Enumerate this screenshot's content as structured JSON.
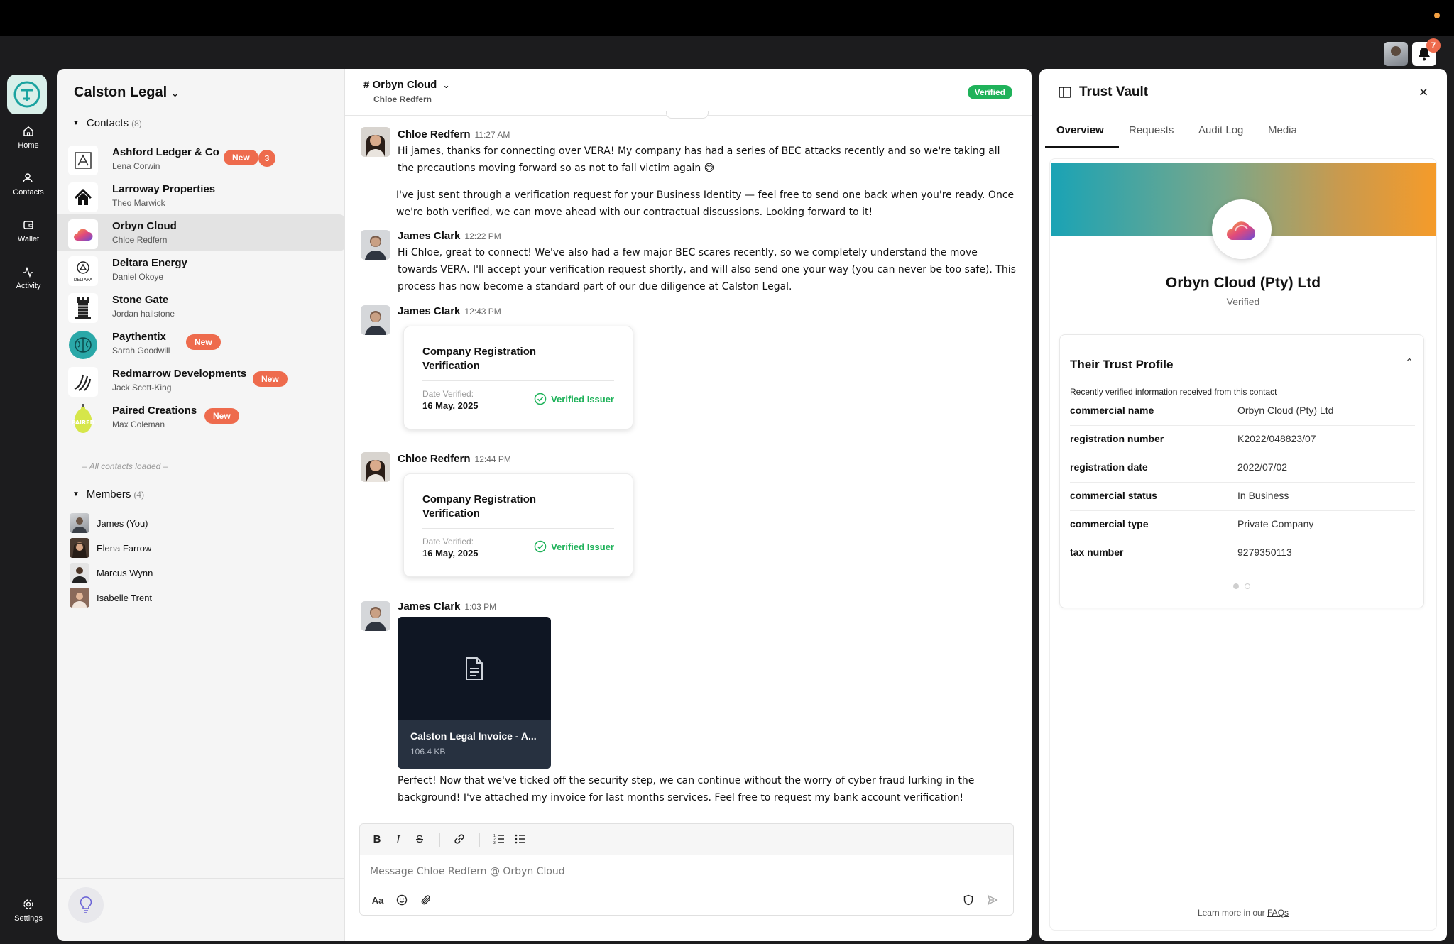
{
  "notifications": {
    "count": "7"
  },
  "rail": {
    "items": [
      {
        "label": "Home",
        "icon": "home-icon"
      },
      {
        "label": "Contacts",
        "icon": "contacts-icon"
      },
      {
        "label": "Wallet",
        "icon": "wallet-icon"
      },
      {
        "label": "Activity",
        "icon": "activity-icon"
      }
    ],
    "settings_label": "Settings"
  },
  "sidebar": {
    "org_name": "Calston Legal",
    "contacts_label": "Contacts",
    "contacts_count": "(8)",
    "contacts": [
      {
        "name": "Ashford Ledger & Co",
        "person": "Lena Corwin",
        "badge": "New",
        "count": "3"
      },
      {
        "name": "Larroway Properties",
        "person": "Theo Marwick"
      },
      {
        "name": "Orbyn Cloud",
        "person": "Chloe Redfern",
        "selected": true
      },
      {
        "name": "Deltara Energy",
        "person": "Daniel Okoye",
        "logo_text": "DELTARA"
      },
      {
        "name": "Stone Gate",
        "person": "Jordan hailstone"
      },
      {
        "name": "Paythentix",
        "person": "Sarah Goodwill",
        "badge": "New"
      },
      {
        "name": "Redmarrow Developments",
        "person": "Jack Scott-King",
        "badge": "New"
      },
      {
        "name": "Paired Creations",
        "person": "Max Coleman",
        "badge": "New",
        "logo_text": "PAIRED"
      }
    ],
    "all_loaded": "– All contacts loaded –",
    "members_label": "Members",
    "members_count": "(4)",
    "members": [
      {
        "name": "James (You)"
      },
      {
        "name": "Elena Farrow"
      },
      {
        "name": "Marcus Wynn"
      },
      {
        "name": "Isabelle Trent"
      }
    ]
  },
  "chat": {
    "channel": "# Orbyn Cloud",
    "subtitle": "Chloe Redfern",
    "status": "Verified",
    "messages": [
      {
        "author": "Chloe Redfern",
        "time": "11:27 AM",
        "text1": "Hi james, thanks for connecting over VERA! My company has had a series of BEC attacks recently and so we're taking all the precautions moving forward so as not to fall victim again 😅",
        "text2": "I've just sent through a verification request for your Business Identity — feel free to send one back when you're ready. Once we're both verified, we can move ahead with our contractual discussions. Looking forward to it!"
      },
      {
        "author": "James Clark",
        "time": "12:22 PM",
        "text1": "Hi Chloe, great to connect! We've also had a few major BEC scares recently, so we completely understand the move towards VERA. I'll accept your verification request shortly, and will also send one your way (you can never be too safe). This process has now become a standard part of our due diligence at Calston Legal."
      },
      {
        "author": "James Clark",
        "time": "12:43 PM",
        "card": {
          "title": "Company Registration Verification",
          "date_label": "Date Verified:",
          "date": "16 May, 2025",
          "issuer": "Verified Issuer"
        }
      },
      {
        "author": "Chloe Redfern",
        "time": "12:44 PM",
        "card": {
          "title": "Company Registration Verification",
          "date_label": "Date Verified:",
          "date": "16 May, 2025",
          "issuer": "Verified Issuer"
        }
      },
      {
        "author": "James Clark",
        "time": "1:03 PM",
        "file": {
          "name": "Calston Legal Invoice - A...",
          "size": "106.4 KB"
        },
        "text1": "Perfect! Now that we've ticked off the security step, we can continue without the worry of cyber fraud lurking in the background! I've attached my invoice for last months services. Feel free to request my bank account verification!"
      }
    ],
    "composer": {
      "placeholder": "Message Chloe Redfern @ Orbyn Cloud",
      "format_label": "Aa"
    }
  },
  "vault": {
    "title": "Trust Vault",
    "tabs": [
      "Overview",
      "Requests",
      "Audit Log",
      "Media"
    ],
    "active_tab": "Overview",
    "org_name": "Orbyn Cloud (Pty) Ltd",
    "org_status": "Verified",
    "trust_profile": {
      "title": "Their Trust Profile",
      "description": "Recently verified information received from this contact",
      "rows": [
        {
          "key": "commercial name",
          "value": "Orbyn Cloud (Pty) Ltd"
        },
        {
          "key": "registration number",
          "value": "K2022/048823/07"
        },
        {
          "key": "registration date",
          "value": "2022/07/02"
        },
        {
          "key": "commercial status",
          "value": "In Business"
        },
        {
          "key": "commercial type",
          "value": "Private Company"
        },
        {
          "key": "tax number",
          "value": "9279350113"
        }
      ]
    },
    "faq_prefix": "Learn more in our",
    "faq_link": "FAQs"
  },
  "colors": {
    "accent_badge": "#ee6b4d",
    "verified_green": "#1fb25a",
    "rail_bg": "#1c1c1e"
  }
}
